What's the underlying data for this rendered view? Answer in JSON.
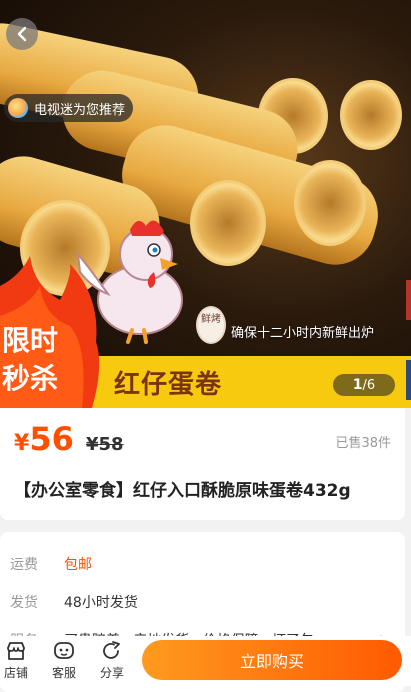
{
  "hero": {
    "recommend_label": "电视迷为您推荐",
    "fresh_badge": "鲜烤",
    "fresh_text": "确保十二小时内新鲜出炉",
    "banner_name": "红仔蛋卷",
    "flash_sale": "限时秒杀",
    "page_current": "1",
    "page_total": "/6"
  },
  "price": {
    "currency": "¥",
    "value": "56",
    "old_price": "¥58",
    "sold": "已售38件"
  },
  "product": {
    "title": "【办公室零食】红仔入口酥脆原味蛋卷432g"
  },
  "info": {
    "rows": [
      {
        "label": "运费",
        "value": "包邮"
      },
      {
        "label": "发货",
        "value": "48小时发货"
      },
      {
        "label": "服务",
        "value": "买贵赔差 · 产地发货 · 价格保障 · 坏了包"
      }
    ]
  },
  "bottom": {
    "shop": "店铺",
    "service": "客服",
    "share": "分享",
    "buy": "立即购买"
  },
  "colors": {
    "accent": "#ff5000",
    "banner": "#f7c90f",
    "brand_brown": "#7b3312"
  }
}
